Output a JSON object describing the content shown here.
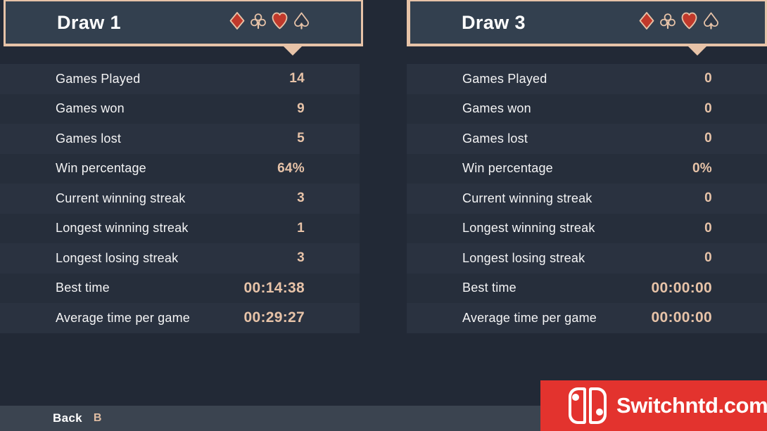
{
  "screen": {
    "background_color": "#222936",
    "accent_color": "#e7c3a8",
    "panel_header_color": "#33404f"
  },
  "panels": [
    {
      "id": "draw-1",
      "title": "Draw 1",
      "suits": [
        "diamond",
        "club",
        "heart",
        "spade"
      ],
      "stats": [
        {
          "label": "Games Played",
          "value": "14"
        },
        {
          "label": "Games won",
          "value": "9"
        },
        {
          "label": "Games lost",
          "value": "5"
        },
        {
          "label": "Win percentage",
          "value": "64%"
        },
        {
          "label": "Current winning streak",
          "value": "3"
        },
        {
          "label": "Longest winning streak",
          "value": "1"
        },
        {
          "label": "Longest losing streak",
          "value": "3"
        },
        {
          "label": "Best time",
          "value": "00:14:38"
        },
        {
          "label": "Average time per game",
          "value": "00:29:27"
        }
      ]
    },
    {
      "id": "draw-3",
      "title": "Draw 3",
      "suits": [
        "diamond",
        "club",
        "heart",
        "spade"
      ],
      "stats": [
        {
          "label": "Games Played",
          "value": "0"
        },
        {
          "label": "Games won",
          "value": "0"
        },
        {
          "label": "Games lost",
          "value": "0"
        },
        {
          "label": "Win percentage",
          "value": "0%"
        },
        {
          "label": "Current winning streak",
          "value": "0"
        },
        {
          "label": "Longest winning streak",
          "value": "0"
        },
        {
          "label": "Longest losing streak",
          "value": "0"
        },
        {
          "label": "Best time",
          "value": "00:00:00"
        },
        {
          "label": "Average time per game",
          "value": "00:00:00"
        }
      ]
    }
  ],
  "footer": {
    "back_label": "Back",
    "back_key": "B"
  },
  "watermark": {
    "text": "Switchntd.com",
    "background_color": "#e3332e"
  }
}
